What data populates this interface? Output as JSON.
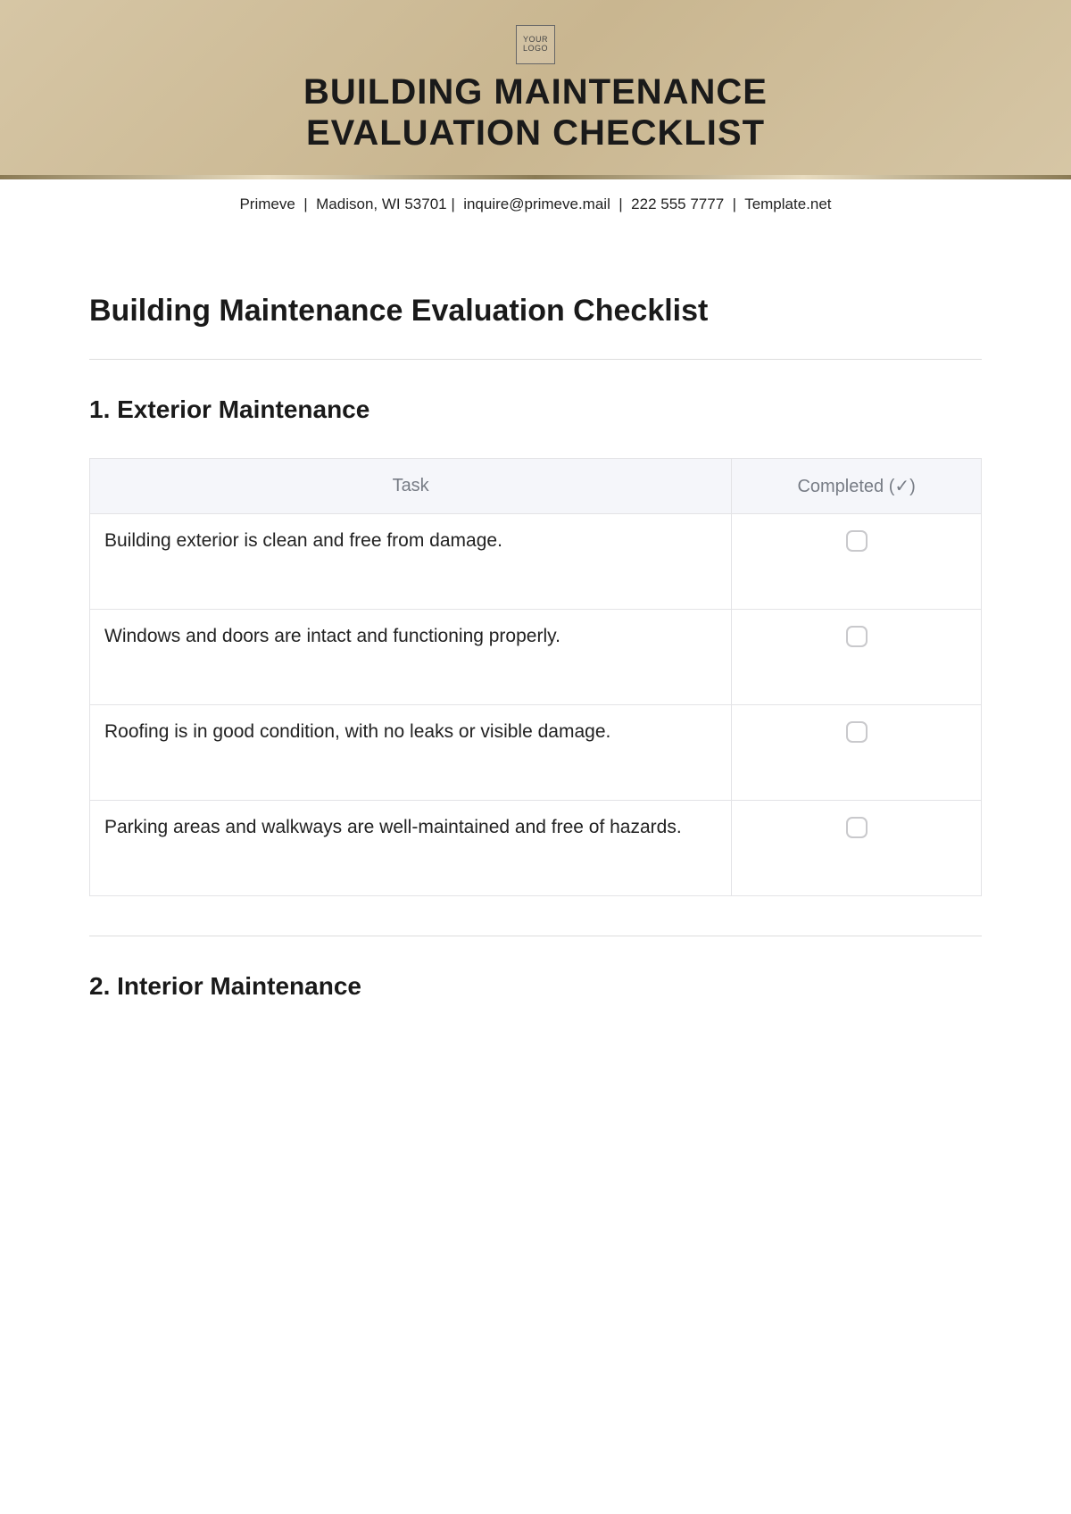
{
  "banner": {
    "logo_text": "YOUR\nLOGO",
    "title_line1": "BUILDING MAINTENANCE",
    "title_line2": "EVALUATION CHECKLIST"
  },
  "meta": {
    "company": "Primeve",
    "address": "Madison, WI 53701",
    "email": "inquire@primeve.mail",
    "phone": "222 555 7777",
    "source": "Template.net"
  },
  "doc_title": "Building Maintenance Evaluation Checklist",
  "sections": [
    {
      "heading": "1. Exterior Maintenance",
      "columns": {
        "task": "Task",
        "completed": "Completed (✓)"
      },
      "rows": [
        {
          "task": "Building exterior is clean and free from damage."
        },
        {
          "task": "Windows and doors are intact and functioning properly."
        },
        {
          "task": "Roofing is in good condition, with no leaks or visible damage."
        },
        {
          "task": "Parking areas and walkways are well-maintained and free of hazards."
        }
      ]
    },
    {
      "heading": "2. Interior Maintenance"
    }
  ]
}
